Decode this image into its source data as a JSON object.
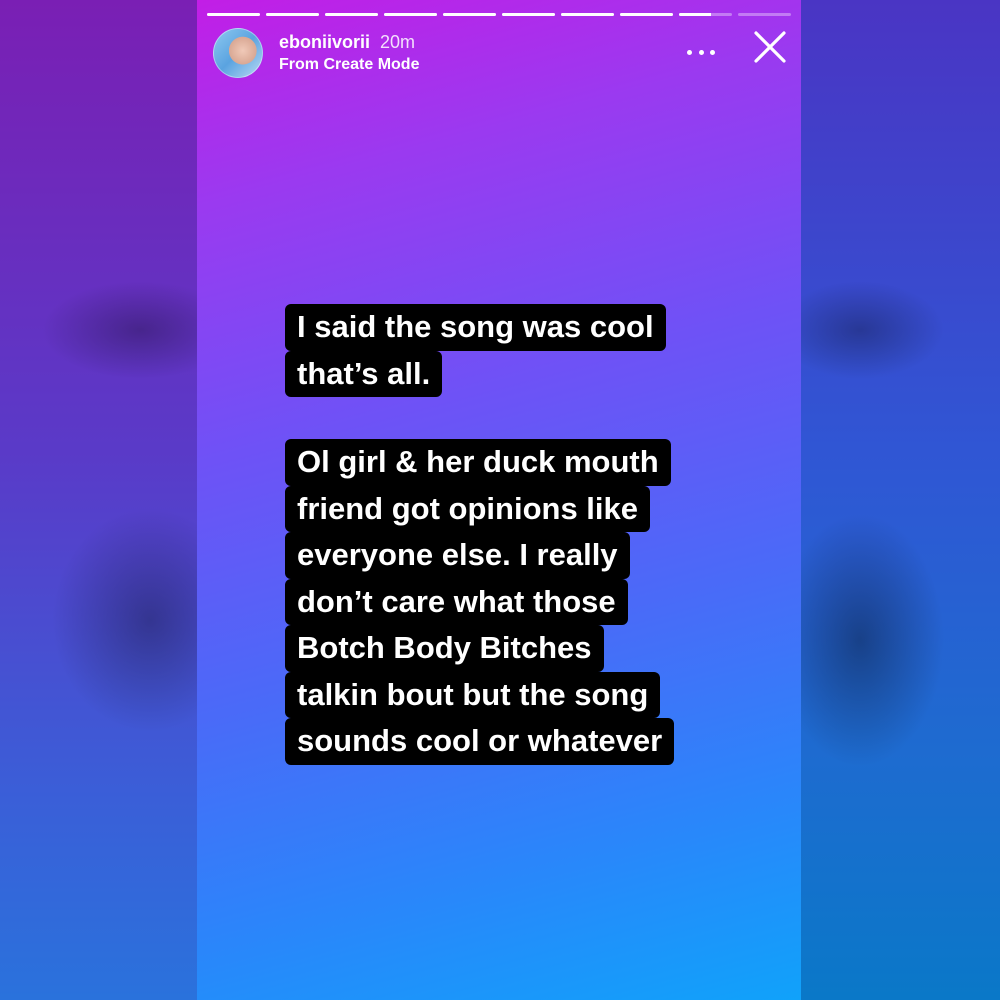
{
  "story": {
    "progress": {
      "segments": 10,
      "current_index": 8,
      "current_fill_fraction": 0.6
    },
    "user": {
      "username": "eboniivorii",
      "time_ago": "20m",
      "subtitle": "From Create Mode"
    },
    "actions": {
      "more_icon": "more-horizontal-icon",
      "close_icon": "close-icon"
    },
    "text_block": {
      "paragraphs": [
        [
          "I said the song was cool",
          "that’s all."
        ],
        [
          "Ol girl & her duck mouth",
          "friend got opinions like",
          "everyone else. I really",
          "don’t care what those",
          "Botch Body Bitches",
          "talkin bout but the song",
          "sounds cool or whatever"
        ]
      ]
    },
    "colors": {
      "gradient_top": "#c21ee6",
      "gradient_bottom": "#10a2fa",
      "text_bg": "#000000",
      "text": "#ffffff"
    }
  }
}
